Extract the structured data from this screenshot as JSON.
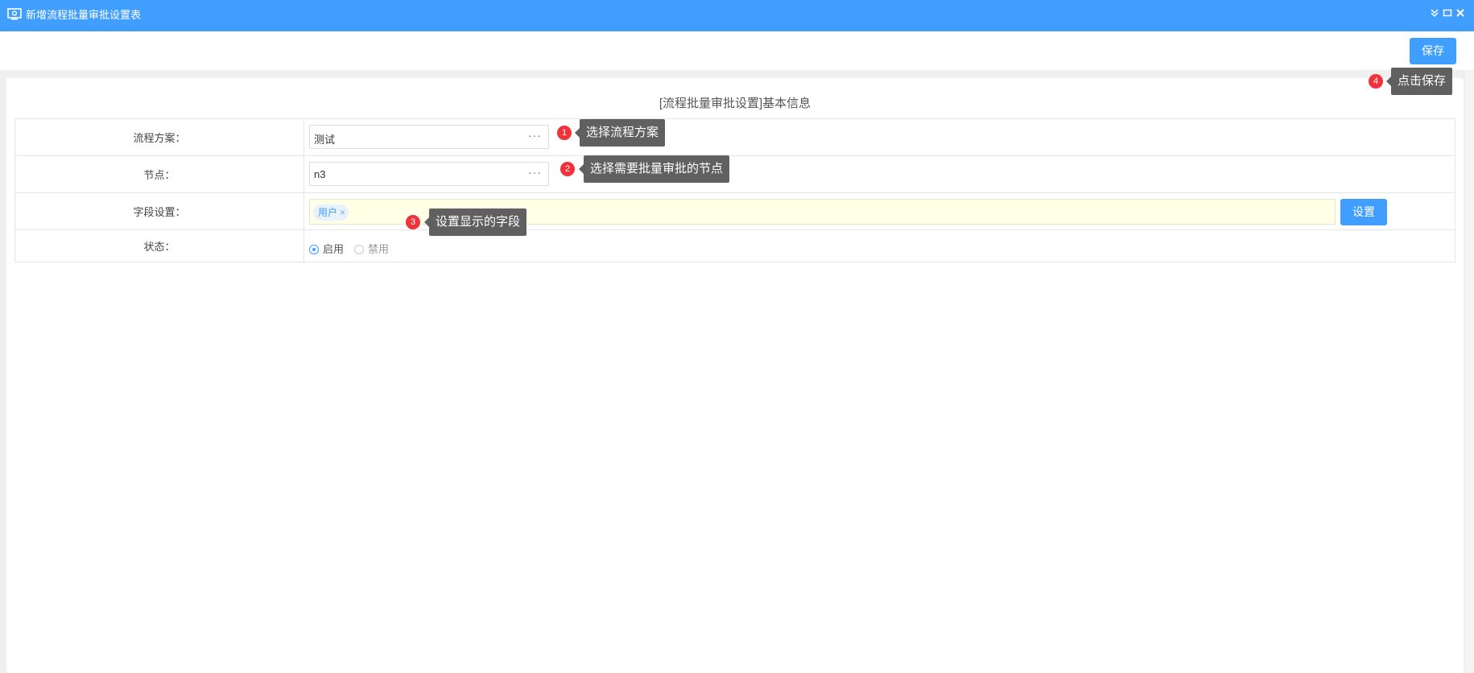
{
  "window": {
    "title": "新增流程批量审批设置表",
    "accent_color": "#409eff",
    "icons": [
      "settings-monitor-icon",
      "collapse-icon",
      "maximize-icon",
      "close-icon"
    ]
  },
  "toolbar": {
    "save_label": "保存"
  },
  "form": {
    "title": "[流程批量审批设置]基本信息",
    "rows": {
      "scheme": {
        "label": "流程方案：",
        "value": "测试",
        "more": "···"
      },
      "node": {
        "label": "节点：",
        "value": "n3",
        "more": "···"
      },
      "fields": {
        "label": "字段设置：",
        "tag": "用户",
        "tag_remove": "×",
        "button": "设置"
      },
      "status": {
        "label": "状态：",
        "options": [
          "启用",
          "禁用"
        ],
        "selected": "启用"
      }
    }
  },
  "annotations": [
    {
      "num": "1",
      "text": "选择流程方案"
    },
    {
      "num": "2",
      "text": "选择需要批量审批的节点"
    },
    {
      "num": "3",
      "text": "设置显示的字段"
    },
    {
      "num": "4",
      "text": "点击保存"
    }
  ]
}
